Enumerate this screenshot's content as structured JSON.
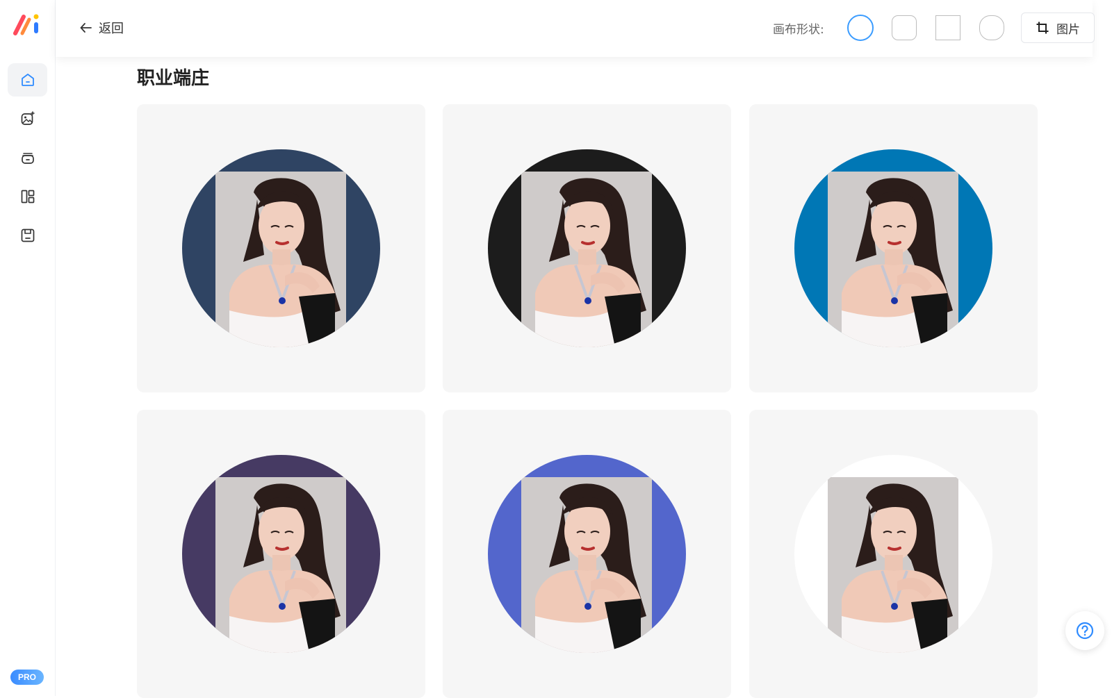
{
  "sidebar": {
    "logo": "ai-logo",
    "items": [
      {
        "name": "home",
        "icon": "home-icon",
        "active": true
      },
      {
        "name": "ai-image",
        "icon": "image-sparkle-icon",
        "active": false
      },
      {
        "name": "box",
        "icon": "box-icon",
        "active": false
      },
      {
        "name": "layout",
        "icon": "layout-icon",
        "active": false
      },
      {
        "name": "save",
        "icon": "save-icon",
        "active": false
      }
    ],
    "pro_badge": "PRO"
  },
  "header": {
    "back_label": "返回",
    "shape_label": "画布形状:",
    "shapes": [
      "circle",
      "rounded-square",
      "square",
      "squircle"
    ],
    "selected_shape": "circle",
    "crop_label": "图片"
  },
  "main": {
    "section_title": "职业端庄",
    "cards": [
      {
        "background": "#2f4463"
      },
      {
        "background": "#1c1c1c"
      },
      {
        "background": "#0077b5"
      },
      {
        "background": "#463a63"
      },
      {
        "background": "#5366cc"
      },
      {
        "background": "#ffffff"
      }
    ]
  },
  "colors": {
    "accent": "#3b9cff",
    "card_bg": "#f6f6f6"
  }
}
